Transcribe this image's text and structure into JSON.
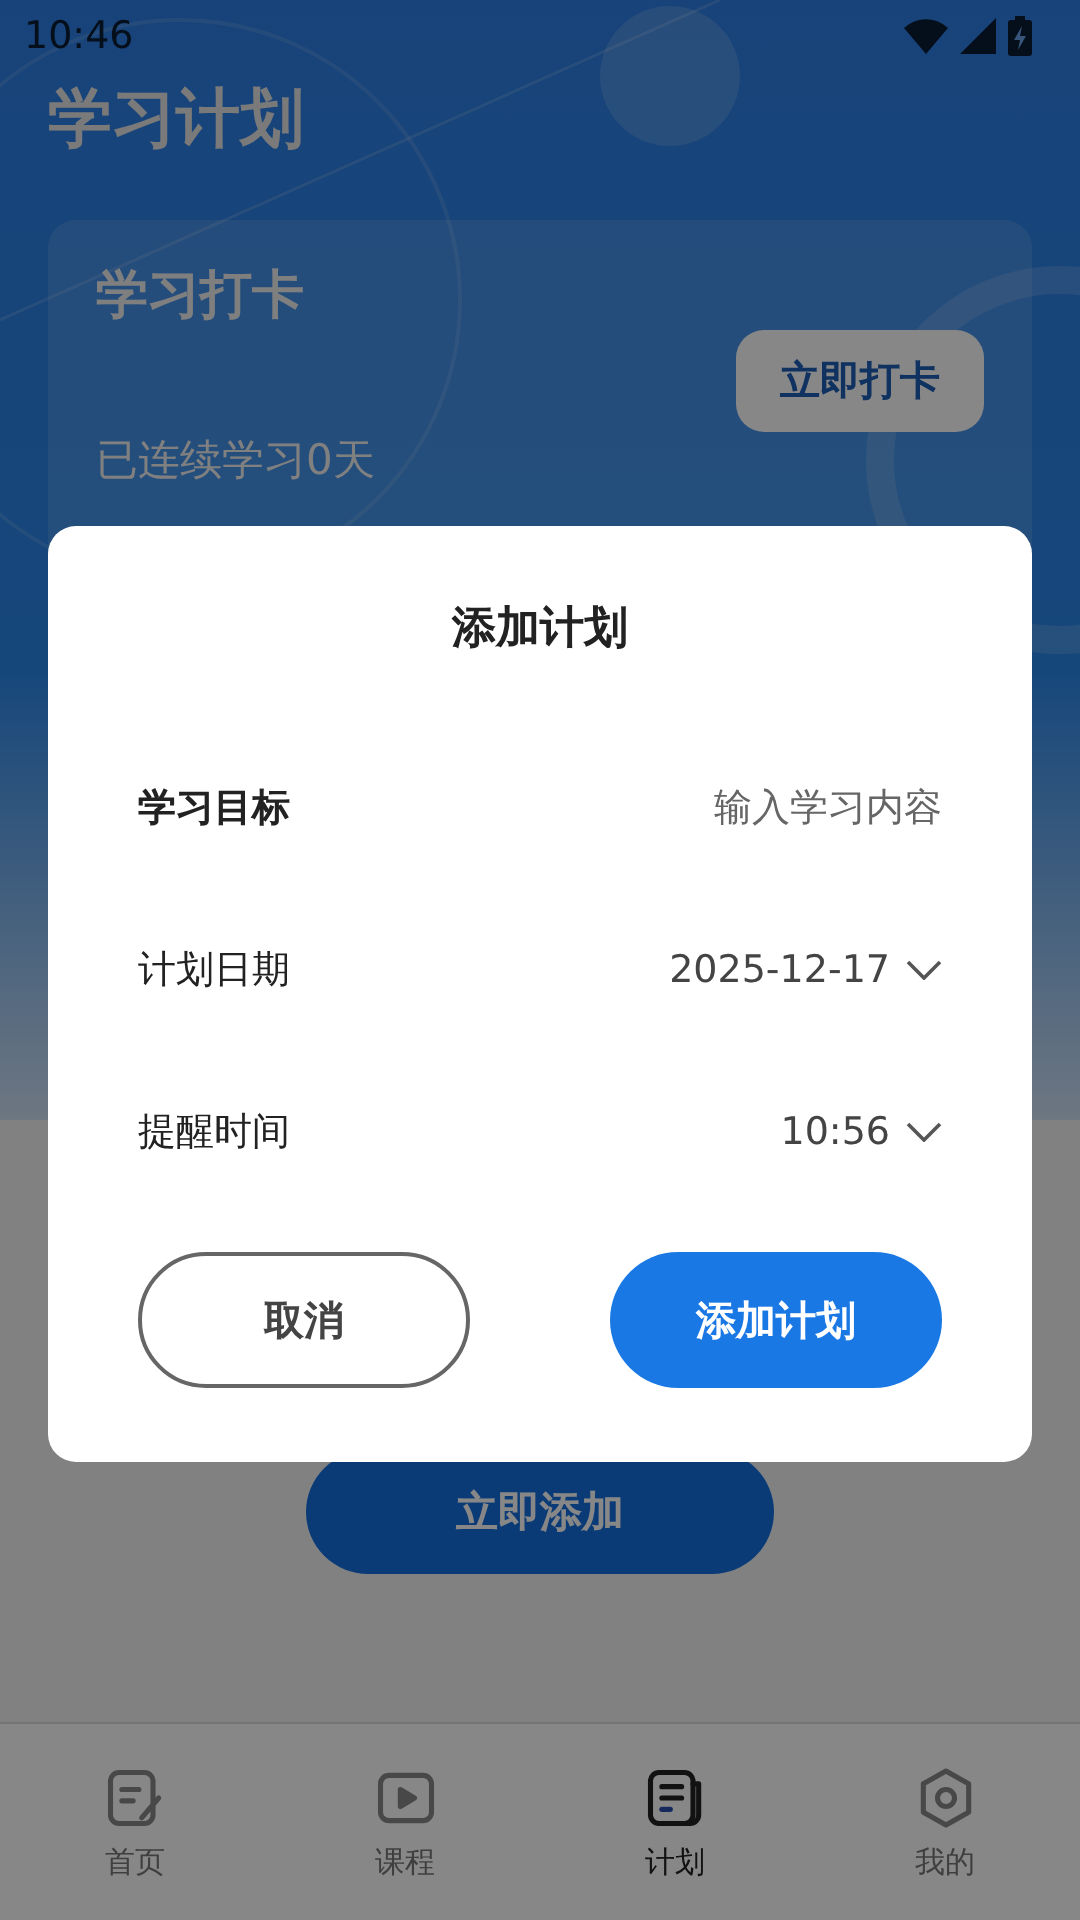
{
  "status_bar": {
    "time": "10:46"
  },
  "page_title": "学习计划",
  "checkin_card": {
    "title": "学习打卡",
    "button": "立即打卡",
    "streak": "已连续学习0天"
  },
  "add_button": "立即添加",
  "dialog": {
    "title": "添加计划",
    "rows": [
      {
        "kind": "input",
        "label": "学习目标",
        "placeholder": "输入学习内容"
      },
      {
        "kind": "picker",
        "label": "计划日期",
        "value": "2025-12-17"
      },
      {
        "kind": "picker",
        "label": "提醒时间",
        "value": "10:56"
      }
    ],
    "cancel": "取消",
    "confirm": "添加计划"
  },
  "nav": [
    {
      "label": "首页",
      "kind": "home",
      "selected": false
    },
    {
      "label": "课程",
      "kind": "course",
      "selected": false
    },
    {
      "label": "计划",
      "kind": "plan",
      "selected": true
    },
    {
      "label": "我的",
      "kind": "settings",
      "selected": false
    }
  ]
}
